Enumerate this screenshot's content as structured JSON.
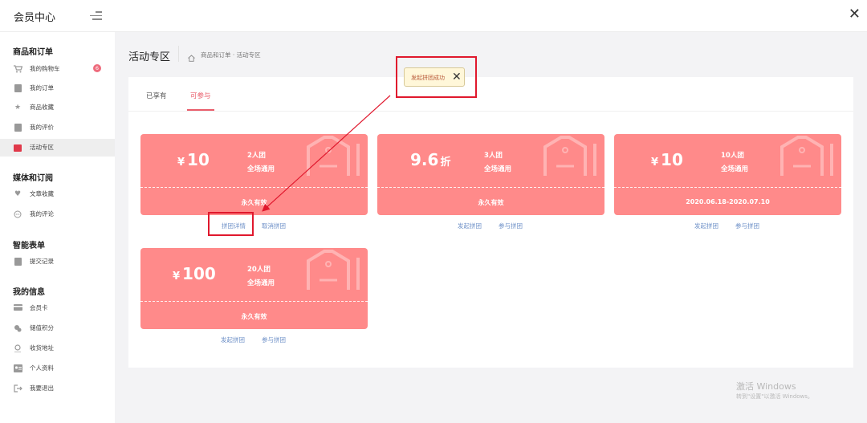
{
  "app": {
    "title": "会员中心"
  },
  "sidebar": {
    "sections": [
      {
        "title": "商品和订单",
        "items": [
          {
            "label": "我的购物车",
            "icon": "cart-icon",
            "badge": "6"
          },
          {
            "label": "我的订单",
            "icon": "order-icon"
          },
          {
            "label": "商品收藏",
            "icon": "star-icon"
          },
          {
            "label": "我的评价",
            "icon": "review-icon"
          },
          {
            "label": "活动专区",
            "icon": "activity-icon",
            "active": true
          }
        ]
      },
      {
        "title": "媒体和订阅",
        "items": [
          {
            "label": "文章收藏",
            "icon": "heart-icon"
          },
          {
            "label": "我的评论",
            "icon": "comment-icon"
          }
        ]
      },
      {
        "title": "智能表单",
        "items": [
          {
            "label": "提交记录",
            "icon": "form-icon"
          }
        ]
      },
      {
        "title": "我的信息",
        "items": [
          {
            "label": "会员卡",
            "icon": "card-icon"
          },
          {
            "label": "储值积分",
            "icon": "points-icon"
          },
          {
            "label": "收货地址",
            "icon": "address-icon"
          },
          {
            "label": "个人资料",
            "icon": "profile-icon"
          },
          {
            "label": "我要退出",
            "icon": "logout-icon"
          }
        ]
      }
    ]
  },
  "header": {
    "title": "活动专区",
    "breadcrumb": "商品和订单 · 活动专区"
  },
  "tabs": [
    {
      "label": "已享有",
      "active": false
    },
    {
      "label": "可参与",
      "active": true
    }
  ],
  "coupons": [
    {
      "currency": "¥",
      "amount": "10",
      "unit": "",
      "group": "2人团",
      "scope": "全场通用",
      "validity": "永久有效",
      "actions": [
        "拼团详情",
        "取消拼团"
      ]
    },
    {
      "currency": "",
      "amount": "9.6",
      "unit": "折",
      "group": "3人团",
      "scope": "全场通用",
      "validity": "永久有效",
      "actions": [
        "发起拼团",
        "参与拼团"
      ]
    },
    {
      "currency": "¥",
      "amount": "10",
      "unit": "",
      "group": "10人团",
      "scope": "全场通用",
      "validity": "2020.06.18-2020.07.10",
      "actions": [
        "发起拼团",
        "参与拼团"
      ]
    },
    {
      "currency": "¥",
      "amount": "100",
      "unit": "",
      "group": "20人团",
      "scope": "全场通用",
      "validity": "永久有效",
      "actions": [
        "发起拼团",
        "参与拼团"
      ]
    }
  ],
  "toast": {
    "message": "发起拼团成功",
    "close": "✕"
  },
  "watermark": {
    "title": "激活 Windows",
    "subtitle": "转到\"设置\"以激活 Windows。"
  },
  "colors": {
    "accent": "#e95d6b",
    "coupon": "#ff8a8a",
    "highlight": "#e0182d",
    "link": "#6c8fc7"
  }
}
